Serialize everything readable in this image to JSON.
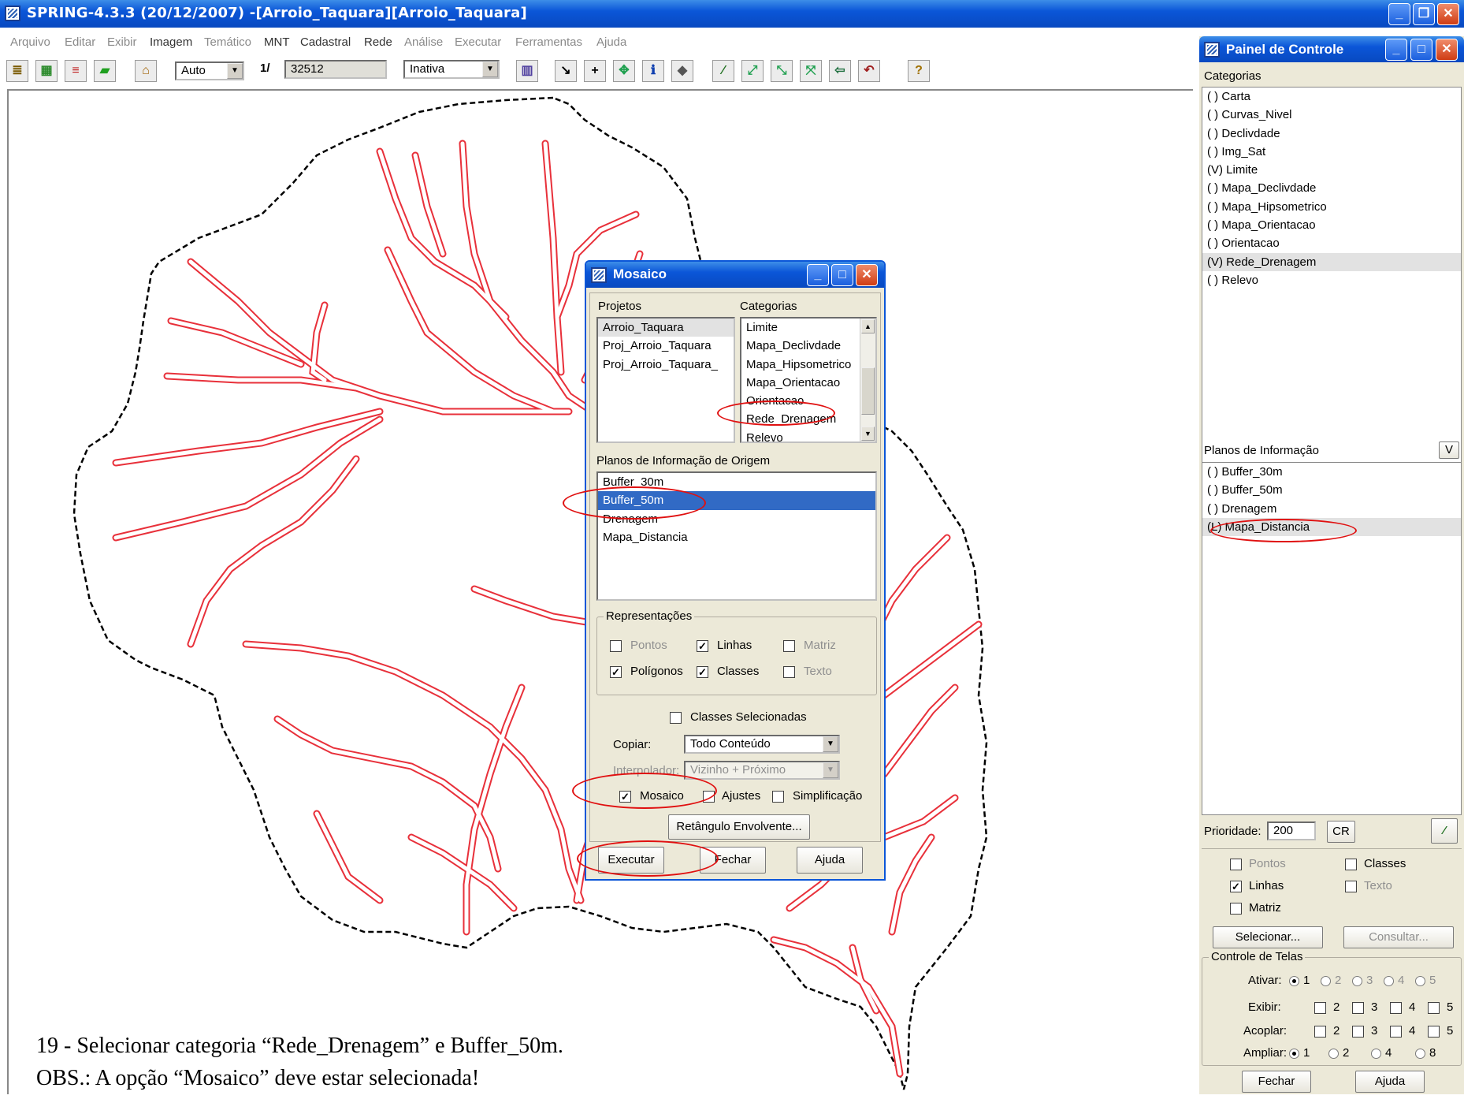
{
  "main_window": {
    "title": "SPRING-4.3.3 (20/12/2007) -[Arroio_Taquara][Arroio_Taquara]",
    "menu": [
      "Arquivo",
      "Editar",
      "Exibir",
      "Imagem",
      "Temático",
      "MNT",
      "Cadastral",
      "Rede",
      "Análise",
      "Executar",
      "Ferramentas",
      "Ajuda"
    ],
    "toolbar": {
      "scale_mode": "Auto",
      "scale_prefix": "1/",
      "scale_value": "32512",
      "cursor_mode": "Inativa"
    }
  },
  "mosaico_dialog": {
    "title": "Mosaico",
    "projetos_label": "Projetos",
    "projetos": [
      "Arroio_Taquara",
      "Proj_Arroio_Taquara",
      "Proj_Arroio_Taquara_"
    ],
    "categorias_label": "Categorias",
    "categorias": [
      "Limite",
      "Mapa_Declivdade",
      "Mapa_Hipsometrico",
      "Mapa_Orientacao",
      "Orientacao",
      "Rede_Drenagem",
      "Relevo"
    ],
    "planos_label": "Planos de Informação de Origem",
    "planos": [
      "Buffer_30m",
      "Buffer_50m",
      "Drenagem",
      "Mapa_Distancia"
    ],
    "selected_plano": "Buffer_50m",
    "representacoes_label": "Representações",
    "representacoes": {
      "pontos": "Pontos",
      "linhas": "Linhas",
      "matriz": "Matriz",
      "poligonos": "Polígonos",
      "classes": "Classes",
      "texto": "Texto"
    },
    "classes_selecionadas": "Classes Selecionadas",
    "copiar_label": "Copiar:",
    "copiar_value": "Todo Conteúdo",
    "interpolador_label": "Interpolador:",
    "interpolador_value": "Vizinho + Próximo",
    "mosaico_label": "Mosaico",
    "ajustes_label": "Ajustes",
    "simplificacao_label": "Simplificação",
    "retangulo_button": "Retângulo Envolvente...",
    "executar_button": "Executar",
    "fechar_button": "Fechar",
    "ajuda_button": "Ajuda"
  },
  "painel_controle": {
    "title": "Painel de Controle",
    "categorias_label": "Categorias",
    "categorias": [
      "( ) Carta",
      "( ) Curvas_Nivel",
      "( ) Declivdade",
      "( ) Img_Sat",
      "(V) Limite",
      "( ) Mapa_Declivdade",
      "( ) Mapa_Hipsometrico",
      "( ) Mapa_Orientacao",
      "( ) Orientacao",
      "(V) Rede_Drenagem",
      "( ) Relevo"
    ],
    "planos_label": "Planos de Informação",
    "planos_mode": "V",
    "planos": [
      "( ) Buffer_30m",
      "( ) Buffer_50m",
      "( ) Drenagem",
      "(L) Mapa_Distancia"
    ],
    "prioridade_label": "Prioridade:",
    "prioridade_value": "200",
    "cr_button": "CR",
    "repr": {
      "pontos": "Pontos",
      "classes": "Classes",
      "linhas": "Linhas",
      "texto": "Texto",
      "matriz": "Matriz"
    },
    "selecionar_button": "Selecionar...",
    "consultar_button": "Consultar...",
    "controle_label": "Controle de Telas",
    "ativar_label": "Ativar:",
    "exibir_label": "Exibir:",
    "acoplar_label": "Acoplar:",
    "ampliar_label": "Ampliar:",
    "telas": [
      "1",
      "2",
      "3",
      "4",
      "5"
    ],
    "ampliar_opts": [
      "1",
      "2",
      "4",
      "8"
    ],
    "fechar_button": "Fechar",
    "ajuda_button": "Ajuda"
  },
  "caption": {
    "line1": "19 -  Selecionar categoria “Rede_Drenagem” e Buffer_50m.",
    "line2": "OBS.: A opção “Mosaico” deve estar selecionada!"
  },
  "colors": {
    "title_bar": "#0b56d8",
    "drainage_buffer": "#e8303a",
    "annotation": "#e01010",
    "selection": "#316ac5"
  }
}
